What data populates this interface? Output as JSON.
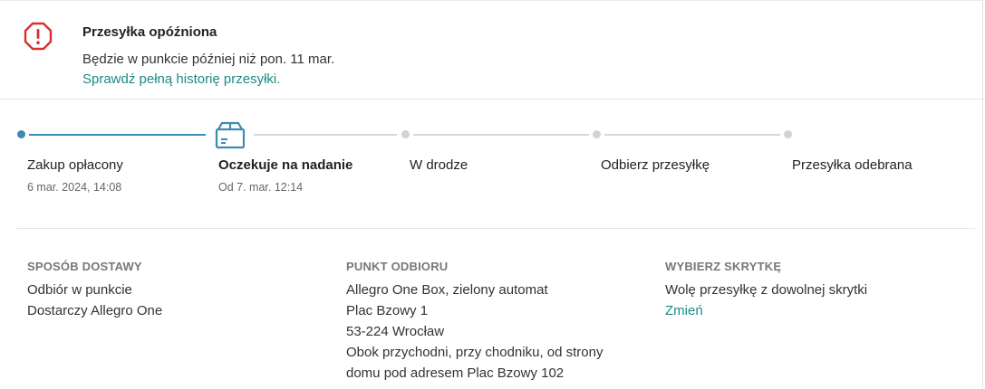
{
  "alert": {
    "icon": "warning-octagon-icon",
    "color": "#d9302e",
    "title": "Przesyłka opóźniona",
    "text": "Będzie w punkcie później niż pon. 11 mar.",
    "link": "Sprawdź pełną historię przesyłki."
  },
  "tracker": {
    "accent": "#3f8ab3",
    "progress_step": 2,
    "steps": [
      {
        "label": "Zakup opłacony",
        "date": "6 mar. 2024, 14:08"
      },
      {
        "label": "Oczekuje na nadanie",
        "date": "Od 7. mar. 12:14",
        "icon": "package-icon",
        "current": true
      },
      {
        "label": "W drodze"
      },
      {
        "label": "Odbierz przesyłkę"
      },
      {
        "label": "Przesyłka odebrana"
      }
    ]
  },
  "details": {
    "delivery": {
      "heading": "SPOSÓB DOSTAWY",
      "lines": [
        "Odbiór w punkcie",
        "Dostarczy Allegro One"
      ]
    },
    "pickup": {
      "heading": "PUNKT ODBIORU",
      "lines": [
        "Allegro One Box, zielony automat",
        "Plac Bzowy 1",
        "53-224 Wrocław",
        "Obok przychodni, przy chodniku, od strony",
        "domu pod adresem Plac Bzowy 102"
      ]
    },
    "locker": {
      "heading": "WYBIERZ SKRYTKĘ",
      "lines": [
        "Wolę przesyłkę z dowolnej skrytki"
      ],
      "link": "Zmień"
    }
  }
}
